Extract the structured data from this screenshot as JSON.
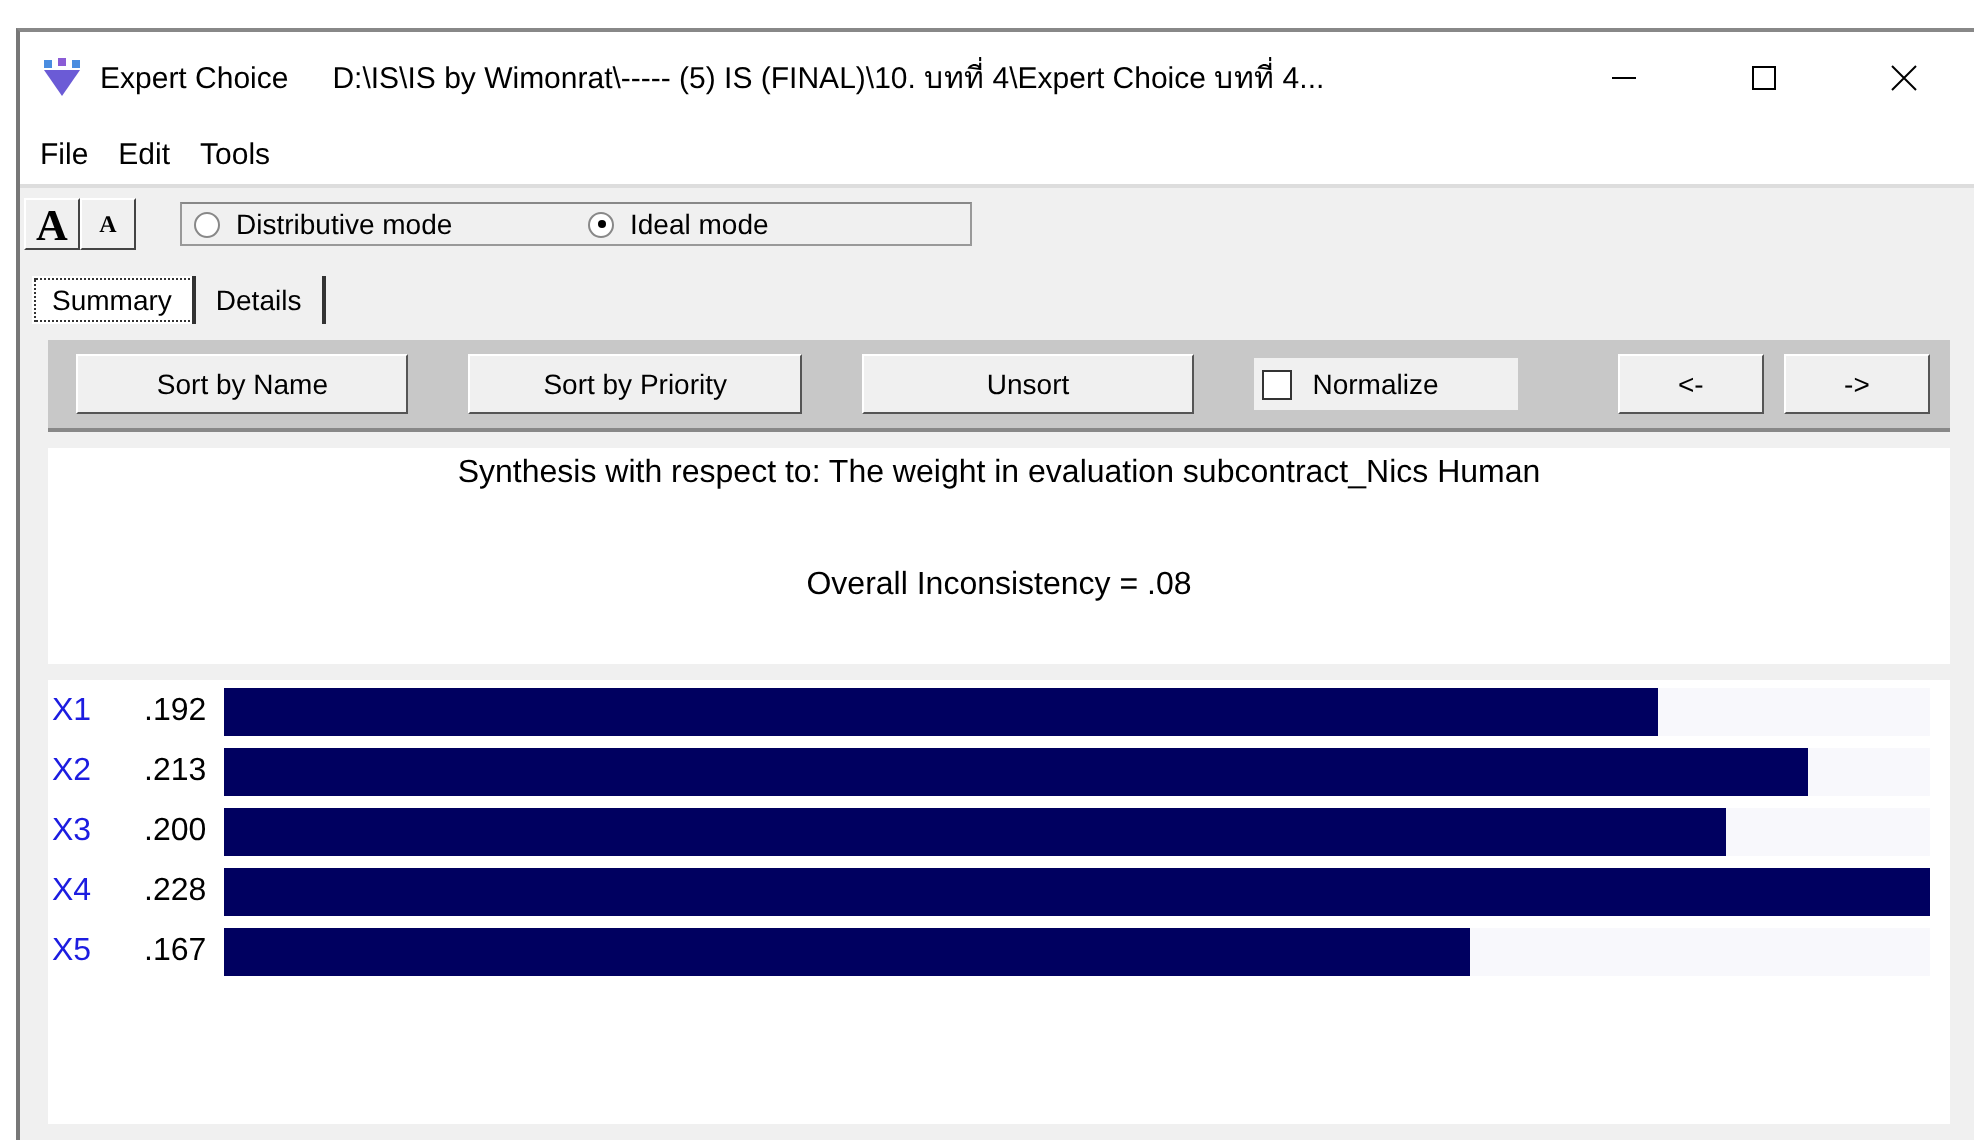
{
  "window": {
    "title": "Expert Choice",
    "path": "D:\\IS\\IS by Wimonrat\\----- (5) IS (FINAL)\\10. บทที่ 4\\Expert Choice บทที่ 4..."
  },
  "menu": [
    "File",
    "Edit",
    "Tools"
  ],
  "font_buttons": [
    {
      "label": "A"
    },
    {
      "label": "A"
    }
  ],
  "modes": [
    {
      "label": "Distributive mode",
      "selected": false
    },
    {
      "label": "Ideal mode",
      "selected": true
    }
  ],
  "tabs": [
    {
      "label": "Summary",
      "selected": true
    },
    {
      "label": "Details",
      "selected": false
    }
  ],
  "buttons": [
    "Sort by Name",
    "Sort by Priority",
    "Unsort"
  ],
  "normalize": {
    "label": "Normalize",
    "checked": false
  },
  "nav_buttons": [
    "<-",
    "->"
  ],
  "synthesis": "Synthesis with respect to: The weight in evaluation subcontract_Nics Human",
  "inconsistency": "Overall Inconsistency = .08",
  "priorities": [
    {
      "name": "X1",
      "value": ".192",
      "level": 0.84
    },
    {
      "name": "X2",
      "value": ".213",
      "level": 0.929
    },
    {
      "name": "X3",
      "value": ".200",
      "level": 0.88
    },
    {
      "name": "X4",
      "value": ".228",
      "level": 1.0
    },
    {
      "name": "X5",
      "value": ".167",
      "level": 0.73
    }
  ]
}
